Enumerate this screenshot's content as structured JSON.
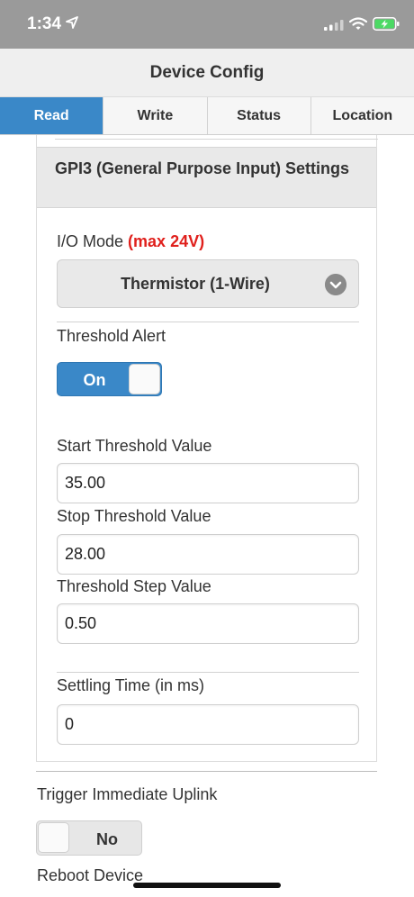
{
  "status_bar": {
    "time": "1:34",
    "icons": [
      "location-arrow-icon",
      "cellular-signal-icon",
      "wifi-icon",
      "battery-charging-icon"
    ],
    "battery_color": "#4cd964"
  },
  "header": {
    "title": "Device Config"
  },
  "tabs": [
    {
      "label": "Read",
      "active": true
    },
    {
      "label": "Write",
      "active": false
    },
    {
      "label": "Status",
      "active": false
    },
    {
      "label": "Location",
      "active": false
    }
  ],
  "section": {
    "title": "GPI3 (General Purpose Input) Settings",
    "io_mode": {
      "label": "I/O Mode",
      "hint": "(max 24V)",
      "selected": "Thermistor (1-Wire)"
    },
    "threshold_alert": {
      "label": "Threshold Alert",
      "state": "On"
    },
    "start_threshold": {
      "label": "Start Threshold Value",
      "value": "35.00"
    },
    "stop_threshold": {
      "label": "Stop Threshold Value",
      "value": "28.00"
    },
    "threshold_step": {
      "label": "Threshold Step Value",
      "value": "0.50"
    },
    "settling_time": {
      "label": "Settling Time (in ms)",
      "value": "0"
    }
  },
  "trigger_uplink": {
    "label": "Trigger Immediate Uplink",
    "state": "No"
  },
  "reboot_device": {
    "label": "Reboot Device"
  },
  "colors": {
    "accent": "#3a88c8",
    "warning": "#e0201c",
    "status_bar": "#9a9a9a"
  }
}
